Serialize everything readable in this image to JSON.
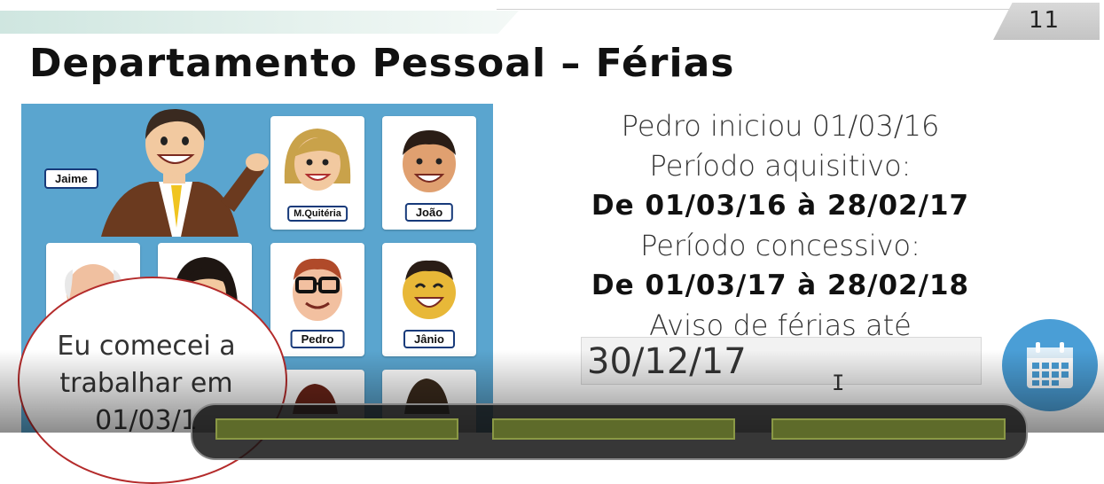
{
  "slide": {
    "page_number": "11",
    "title": "Departamento Pessoal – Férias"
  },
  "characters": {
    "jaime": "Jaime",
    "cards": [
      {
        "name": "M.Quitéria"
      },
      {
        "name": "João"
      },
      {
        "name": "Pedro"
      },
      {
        "name": "Jânio"
      }
    ]
  },
  "speech_bubble": {
    "lines": [
      "Eu comecei a",
      "trabalhar em",
      "01/03/1"
    ]
  },
  "info": {
    "line1": "Pedro iniciou 01/03/16",
    "acq_label": "Período aquisitivo:",
    "acq_value": "De 01/03/16 à 28/02/17",
    "con_label": "Período concessivo:",
    "con_value": "De 01/03/17 à 28/02/18",
    "notice_label": "Aviso de férias até"
  },
  "notice_input": {
    "value": "30/12/17"
  },
  "icons": {
    "calendar": "calendar-icon",
    "text_cursor": "text-cursor-icon"
  },
  "colors": {
    "panel": "#5aa5cf",
    "tag_border": "#173a7a",
    "bubble_border": "#b42b2b",
    "calendar_button": "#4a9ed6",
    "control_button": "#5e6b2a"
  }
}
